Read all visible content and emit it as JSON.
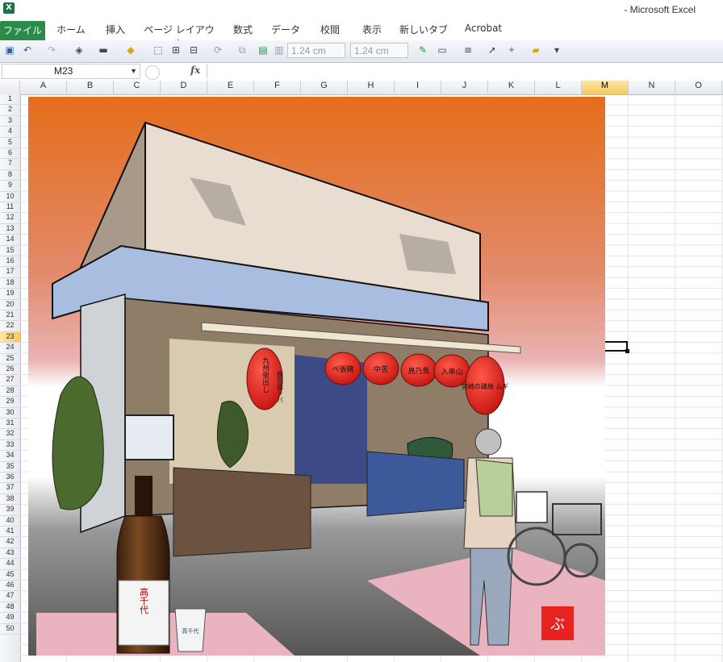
{
  "app": {
    "title": "- Microsoft Excel",
    "logo_letter": "X"
  },
  "ribbon_tabs": [
    "ファイル",
    "ホーム",
    "挿入",
    "ページ レイアウト",
    "数式",
    "データ",
    "校閲",
    "表示",
    "新しいタブ",
    "Acrobat"
  ],
  "toolbar": {
    "height_value": "1.24 cm",
    "width_value": "1.24 cm"
  },
  "formula_bar": {
    "name_box": "M23",
    "fx": "fx",
    "formula": ""
  },
  "columns": [
    "A",
    "B",
    "C",
    "D",
    "E",
    "F",
    "G",
    "H",
    "I",
    "J",
    "K",
    "L",
    "M",
    "N",
    "O"
  ],
  "selected_column": "M",
  "selected_row": "23",
  "rows": [
    "1",
    "2",
    "3",
    "4",
    "5",
    "6",
    "7",
    "8",
    "9",
    "10",
    "11",
    "12",
    "13",
    "14",
    "15",
    "16",
    "17",
    "18",
    "19",
    "20",
    "21",
    "22",
    "23",
    "24",
    "25",
    "26",
    "27",
    "28",
    "29",
    "30",
    "31",
    "32",
    "33",
    "34",
    "35",
    "36",
    "37",
    "38",
    "39",
    "40",
    "41",
    "42",
    "43",
    "44",
    "45",
    "46",
    "47",
    "48",
    "49",
    "50"
  ],
  "artwork": {
    "lanterns": [
      "九州泉出し",
      "ぺ張鶏",
      "中苦",
      "鳥乃焦",
      "入串山",
      "宮崎の鶏焼 ムギ"
    ],
    "side_sign": "鹿児島ソバ",
    "bottle_label": "高千代",
    "cup_label": "高千代",
    "signature": "ぶ",
    "colors": {
      "sky_top": "#e46d1a",
      "sky_bottom": "#f6e7ea",
      "lantern": "#e8231f"
    }
  }
}
